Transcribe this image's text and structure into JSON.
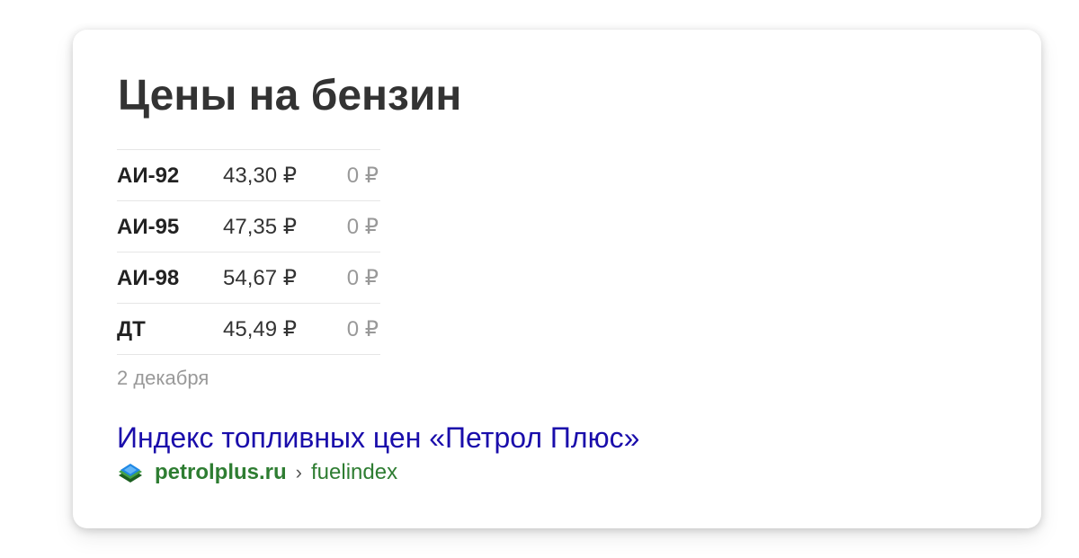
{
  "card": {
    "title": "Цены на бензин",
    "prices": [
      {
        "fuel": "АИ-92",
        "price": "43,30 ₽",
        "change": "0 ₽"
      },
      {
        "fuel": "АИ-95",
        "price": "47,35 ₽",
        "change": "0 ₽"
      },
      {
        "fuel": "АИ-98",
        "price": "54,67 ₽",
        "change": "0 ₽"
      },
      {
        "fuel": "ДТ",
        "price": "45,49 ₽",
        "change": "0 ₽"
      }
    ],
    "date": "2 декабря",
    "source": {
      "title": "Индекс топливных цен «Петрол Плюс»",
      "domain": "petrolplus.ru",
      "separator": "›",
      "path": "fuelindex",
      "favicon": "petrolplus-logo-icon"
    }
  },
  "colors": {
    "link": "#1a0dab",
    "url_green": "#2e7d32",
    "muted": "#999999"
  }
}
